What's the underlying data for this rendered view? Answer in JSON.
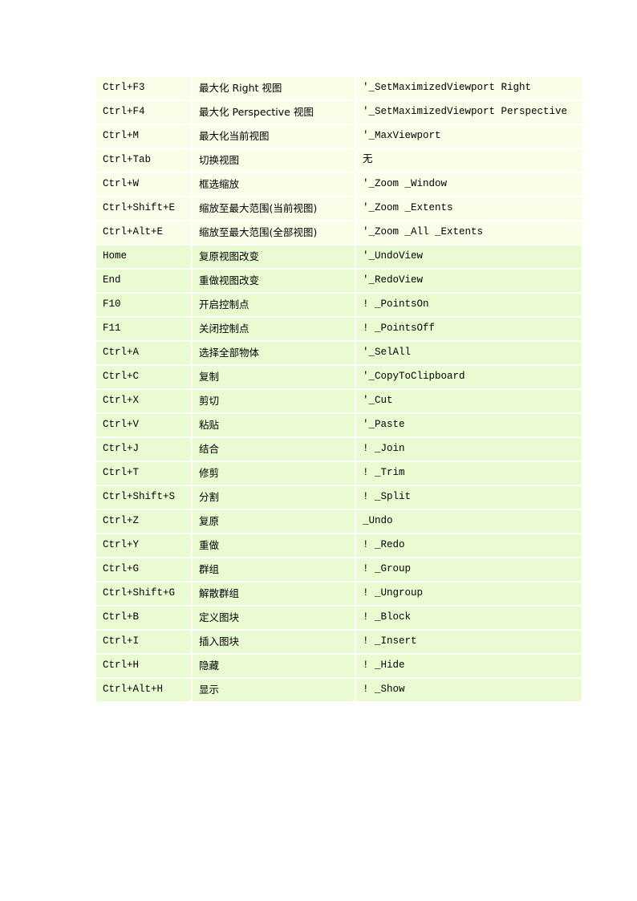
{
  "document": {
    "type": "shortcut-reference-table",
    "columns": [
      "key",
      "description",
      "command"
    ],
    "colors": {
      "row_ivory": "#fbfde9",
      "row_green": "#eafbd2",
      "page_background": "#ffffff",
      "text": "#000000"
    },
    "rows": [
      {
        "key": "Ctrl+F3",
        "desc": "最大化 Right 视图",
        "cmd": "'_SetMaximizedViewport Right",
        "style": "ivory"
      },
      {
        "key": "Ctrl+F4",
        "desc": "最大化 Perspective 视图",
        "cmd": "'_SetMaximizedViewport Perspective",
        "style": "ivory"
      },
      {
        "key": "Ctrl+M",
        "desc": "最大化当前视图",
        "cmd": "'_MaxViewport",
        "style": "ivory"
      },
      {
        "key": "Ctrl+Tab",
        "desc": "切换视图",
        "cmd": "无",
        "style": "ivory"
      },
      {
        "key": "Ctrl+W",
        "desc": "框选缩放",
        "cmd": "'_Zoom _Window",
        "style": "ivory"
      },
      {
        "key": "Ctrl+Shift+E",
        "desc": "缩放至最大范围(当前视图)",
        "cmd": "'_Zoom _Extents",
        "style": "ivory"
      },
      {
        "key": "Ctrl+Alt+E",
        "desc": "缩放至最大范围(全部视图)",
        "cmd": "'_Zoom _All _Extents",
        "style": "ivory"
      },
      {
        "key": "Home",
        "desc": "复原视图改变",
        "cmd": "'_UndoView",
        "style": "green"
      },
      {
        "key": "End",
        "desc": "重做视图改变",
        "cmd": "'_RedoView",
        "style": "green"
      },
      {
        "key": "F10",
        "desc": "开启控制点",
        "cmd": "! _PointsOn",
        "style": "green"
      },
      {
        "key": "F11",
        "desc": "关闭控制点",
        "cmd": "! _PointsOff",
        "style": "green"
      },
      {
        "key": "Ctrl+A",
        "desc": "选择全部物体",
        "cmd": "'_SelAll",
        "style": "green"
      },
      {
        "key": "Ctrl+C",
        "desc": "复制",
        "cmd": "'_CopyToClipboard",
        "style": "green"
      },
      {
        "key": "Ctrl+X",
        "desc": "剪切",
        "cmd": "'_Cut",
        "style": "green"
      },
      {
        "key": "Ctrl+V",
        "desc": "粘贴",
        "cmd": "'_Paste",
        "style": "green"
      },
      {
        "key": "Ctrl+J",
        "desc": "结合",
        "cmd": "! _Join",
        "style": "green"
      },
      {
        "key": "Ctrl+T",
        "desc": "修剪",
        "cmd": "! _Trim",
        "style": "green"
      },
      {
        "key": "Ctrl+Shift+S",
        "desc": "分割",
        "cmd": "! _Split",
        "style": "green"
      },
      {
        "key": "Ctrl+Z",
        "desc": "复原",
        "cmd": "_Undo",
        "style": "green"
      },
      {
        "key": "Ctrl+Y",
        "desc": "重做",
        "cmd": "! _Redo",
        "style": "green"
      },
      {
        "key": "Ctrl+G",
        "desc": "群组",
        "cmd": "! _Group",
        "style": "green"
      },
      {
        "key": "Ctrl+Shift+G",
        "desc": "解散群组",
        "cmd": "! _Ungroup",
        "style": "green"
      },
      {
        "key": "Ctrl+B",
        "desc": "定义图块",
        "cmd": "! _Block",
        "style": "green"
      },
      {
        "key": "Ctrl+I",
        "desc": "插入图块",
        "cmd": "! _Insert",
        "style": "green"
      },
      {
        "key": "Ctrl+H",
        "desc": "隐藏",
        "cmd": "! _Hide",
        "style": "green"
      },
      {
        "key": "Ctrl+Alt+H",
        "desc": "显示",
        "cmd": "! _Show",
        "style": "green"
      }
    ]
  }
}
